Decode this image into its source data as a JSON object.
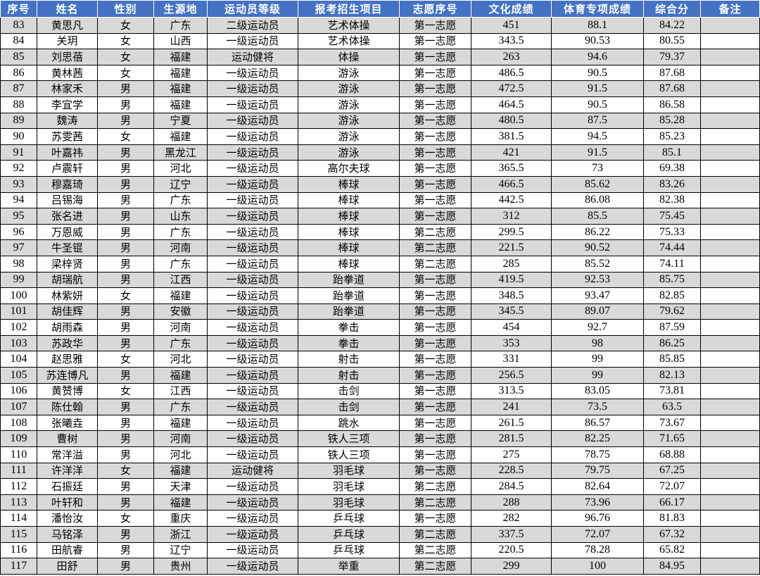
{
  "columns": [
    "序号",
    "姓名",
    "性别",
    "生源地",
    "运动员等级",
    "报考招生项目",
    "志愿序号",
    "文化成绩",
    "体育专项成绩",
    "综合分",
    "备注"
  ],
  "rows": [
    [
      "83",
      "黄思凡",
      "女",
      "广东",
      "二级运动员",
      "艺术体操",
      "第一志愿",
      "451",
      "88.1",
      "84.22",
      ""
    ],
    [
      "84",
      "关玥",
      "女",
      "山西",
      "一级运动员",
      "艺术体操",
      "第一志愿",
      "343.5",
      "90.53",
      "80.55",
      ""
    ],
    [
      "85",
      "刘思蓓",
      "女",
      "福建",
      "运动健将",
      "体操",
      "第一志愿",
      "263",
      "94.6",
      "79.37",
      ""
    ],
    [
      "86",
      "黄林茜",
      "女",
      "福建",
      "一级运动员",
      "游泳",
      "第一志愿",
      "486.5",
      "90.5",
      "87.68",
      ""
    ],
    [
      "87",
      "林家禾",
      "男",
      "福建",
      "一级运动员",
      "游泳",
      "第一志愿",
      "472.5",
      "91.5",
      "87.68",
      ""
    ],
    [
      "88",
      "李宜学",
      "男",
      "福建",
      "一级运动员",
      "游泳",
      "第一志愿",
      "464.5",
      "90.5",
      "86.58",
      ""
    ],
    [
      "89",
      "魏涛",
      "男",
      "宁夏",
      "一级运动员",
      "游泳",
      "第一志愿",
      "480.5",
      "87.5",
      "85.28",
      ""
    ],
    [
      "90",
      "苏雯茜",
      "女",
      "福建",
      "一级运动员",
      "游泳",
      "第一志愿",
      "381.5",
      "94.5",
      "85.23",
      ""
    ],
    [
      "91",
      "叶嘉祎",
      "男",
      "黑龙江",
      "一级运动员",
      "游泳",
      "第一志愿",
      "421",
      "91.5",
      "85.1",
      ""
    ],
    [
      "92",
      "卢震轩",
      "男",
      "河北",
      "一级运动员",
      "高尔夫球",
      "第一志愿",
      "365.5",
      "73",
      "69.38",
      ""
    ],
    [
      "93",
      "穆嘉琦",
      "男",
      "辽宁",
      "一级运动员",
      "棒球",
      "第一志愿",
      "466.5",
      "85.62",
      "83.26",
      ""
    ],
    [
      "94",
      "吕锡海",
      "男",
      "广东",
      "一级运动员",
      "棒球",
      "第一志愿",
      "442.5",
      "86.08",
      "82.38",
      ""
    ],
    [
      "95",
      "张名进",
      "男",
      "山东",
      "一级运动员",
      "棒球",
      "第一志愿",
      "312",
      "85.5",
      "75.45",
      ""
    ],
    [
      "96",
      "万恩威",
      "男",
      "广东",
      "一级运动员",
      "棒球",
      "第二志愿",
      "299.5",
      "86.22",
      "75.33",
      ""
    ],
    [
      "97",
      "牛圣锟",
      "男",
      "河南",
      "一级运动员",
      "棒球",
      "第二志愿",
      "221.5",
      "90.52",
      "74.44",
      ""
    ],
    [
      "98",
      "梁梓贤",
      "男",
      "广东",
      "一级运动员",
      "棒球",
      "第二志愿",
      "285",
      "85.52",
      "74.11",
      ""
    ],
    [
      "99",
      "胡瑞航",
      "男",
      "江西",
      "一级运动员",
      "跆拳道",
      "第一志愿",
      "419.5",
      "92.53",
      "85.75",
      ""
    ],
    [
      "100",
      "林紫妍",
      "女",
      "福建",
      "一级运动员",
      "跆拳道",
      "第一志愿",
      "348.5",
      "93.47",
      "82.85",
      ""
    ],
    [
      "101",
      "胡佳辉",
      "男",
      "安徽",
      "一级运动员",
      "跆拳道",
      "第一志愿",
      "345.5",
      "89.07",
      "79.62",
      ""
    ],
    [
      "102",
      "胡雨森",
      "男",
      "河南",
      "一级运动员",
      "拳击",
      "第一志愿",
      "454",
      "92.7",
      "87.59",
      ""
    ],
    [
      "103",
      "苏政华",
      "男",
      "广东",
      "一级运动员",
      "拳击",
      "第一志愿",
      "353",
      "98",
      "86.25",
      ""
    ],
    [
      "104",
      "赵思雅",
      "女",
      "河北",
      "一级运动员",
      "射击",
      "第一志愿",
      "331",
      "99",
      "85.85",
      ""
    ],
    [
      "105",
      "苏连博凡",
      "男",
      "福建",
      "一级运动员",
      "射击",
      "第一志愿",
      "256.5",
      "99",
      "82.13",
      ""
    ],
    [
      "106",
      "黄赞博",
      "女",
      "江西",
      "一级运动员",
      "击剑",
      "第一志愿",
      "313.5",
      "83.05",
      "73.81",
      ""
    ],
    [
      "107",
      "陈仕翰",
      "男",
      "广东",
      "一级运动员",
      "击剑",
      "第一志愿",
      "241",
      "73.5",
      "63.5",
      ""
    ],
    [
      "108",
      "张曦垚",
      "男",
      "福建",
      "一级运动员",
      "跳水",
      "第一志愿",
      "261.5",
      "86.57",
      "73.67",
      ""
    ],
    [
      "109",
      "曹树",
      "男",
      "河南",
      "一级运动员",
      "铁人三项",
      "第一志愿",
      "281.5",
      "82.25",
      "71.65",
      ""
    ],
    [
      "110",
      "常洋溢",
      "男",
      "河北",
      "一级运动员",
      "铁人三项",
      "第一志愿",
      "275",
      "78.75",
      "68.88",
      ""
    ],
    [
      "111",
      "许洋洋",
      "女",
      "福建",
      "运动健将",
      "羽毛球",
      "第一志愿",
      "228.5",
      "79.75",
      "67.25",
      ""
    ],
    [
      "112",
      "石振廷",
      "男",
      "天津",
      "一级运动员",
      "羽毛球",
      "第二志愿",
      "284.5",
      "82.64",
      "72.07",
      ""
    ],
    [
      "113",
      "叶轩和",
      "男",
      "福建",
      "一级运动员",
      "羽毛球",
      "第二志愿",
      "288",
      "73.96",
      "66.17",
      ""
    ],
    [
      "114",
      "潘怡汝",
      "女",
      "重庆",
      "一级运动员",
      "乒乓球",
      "第一志愿",
      "282",
      "96.76",
      "81.83",
      ""
    ],
    [
      "115",
      "马铭泽",
      "男",
      "浙江",
      "一级运动员",
      "乒乓球",
      "第二志愿",
      "337.5",
      "72.07",
      "67.32",
      ""
    ],
    [
      "116",
      "田航睿",
      "男",
      "辽宁",
      "一级运动员",
      "乒乓球",
      "第二志愿",
      "220.5",
      "78.28",
      "65.82",
      ""
    ],
    [
      "117",
      "田舒",
      "男",
      "贵州",
      "一级运动员",
      "举重",
      "第二志愿",
      "299",
      "100",
      "84.95",
      ""
    ]
  ],
  "colors": {
    "header_bg": "#4472c4",
    "header_text": "#ffffff",
    "alt_row_bg": "#d9d9d9",
    "row_bg": "#ffffff"
  }
}
